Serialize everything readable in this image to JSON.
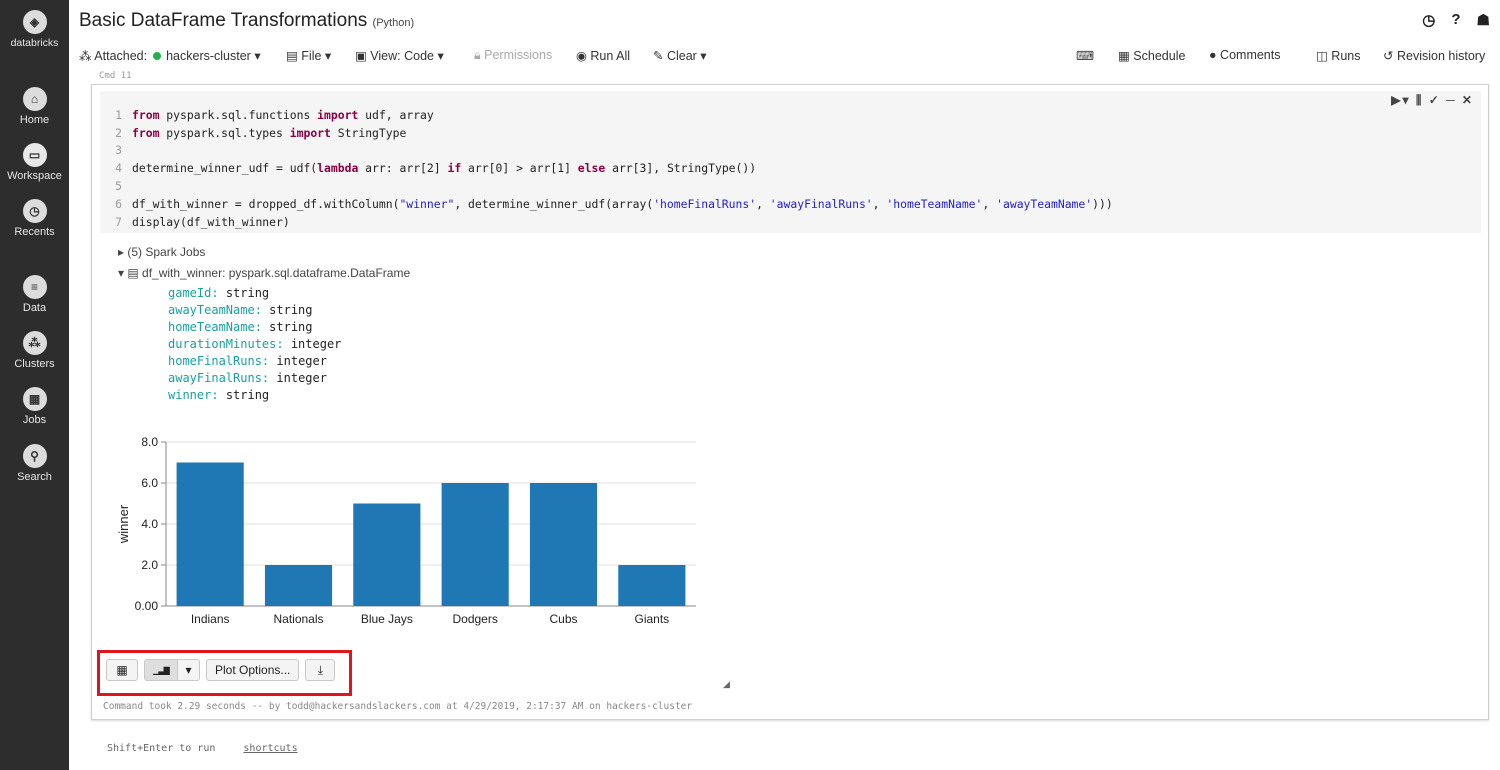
{
  "sidebar": {
    "brand": "databricks",
    "items": [
      {
        "label": "Home",
        "icon": "home-icon",
        "glyph": "⌂"
      },
      {
        "label": "Workspace",
        "icon": "folder-icon",
        "glyph": "▭"
      },
      {
        "label": "Recents",
        "icon": "clock-icon",
        "glyph": "◷"
      },
      {
        "label": "Data",
        "icon": "database-icon",
        "glyph": "≡"
      },
      {
        "label": "Clusters",
        "icon": "clusters-icon",
        "glyph": "⁂"
      },
      {
        "label": "Jobs",
        "icon": "calendar-icon",
        "glyph": "▦"
      },
      {
        "label": "Search",
        "icon": "search-icon",
        "glyph": "⚲"
      }
    ]
  },
  "header": {
    "title": "Basic DataFrame Transformations",
    "language": "(Python)",
    "icons": {
      "clock": "◷",
      "help": "?",
      "user": "☗"
    }
  },
  "toolbar": {
    "attached_label": "Attached:",
    "cluster": "hackers-cluster ▾",
    "file": "File ▾",
    "view": "View: Code ▾",
    "permissions": "Permissions",
    "run_all": "Run All",
    "clear": "Clear ▾",
    "keyboard": "⌨",
    "schedule": "Schedule",
    "comments": "Comments",
    "runs": "Runs",
    "revision": "Revision history"
  },
  "cell": {
    "label": "Cmd 11",
    "tools": "▶▾ ⫼ ✓ ─ ✕",
    "code_lines": [
      {
        "n": "1",
        "parts": [
          [
            "kw",
            "from"
          ],
          [
            "p",
            " pyspark.sql.functions "
          ],
          [
            "kw",
            "import"
          ],
          [
            "p",
            " udf, array"
          ]
        ]
      },
      {
        "n": "2",
        "parts": [
          [
            "kw",
            "from"
          ],
          [
            "p",
            " pyspark.sql.types "
          ],
          [
            "kw",
            "import"
          ],
          [
            "p",
            " StringType"
          ]
        ]
      },
      {
        "n": "3",
        "parts": []
      },
      {
        "n": "4",
        "parts": [
          [
            "p",
            "determine_winner_udf = udf("
          ],
          [
            "kw",
            "lambda"
          ],
          [
            "p",
            " arr: arr[2] "
          ],
          [
            "kw",
            "if"
          ],
          [
            "p",
            " arr[0] > arr[1] "
          ],
          [
            "kw",
            "else"
          ],
          [
            "p",
            " arr[3], StringType())"
          ]
        ]
      },
      {
        "n": "5",
        "parts": []
      },
      {
        "n": "6",
        "parts": [
          [
            "p",
            "df_with_winner = dropped_df.withColumn("
          ],
          [
            "str",
            "\"winner\""
          ],
          [
            "p",
            ", determine_winner_udf(array("
          ],
          [
            "str",
            "'homeFinalRuns'"
          ],
          [
            "p",
            ", "
          ],
          [
            "str",
            "'awayFinalRuns'"
          ],
          [
            "p",
            ", "
          ],
          [
            "str",
            "'homeTeamName'"
          ],
          [
            "p",
            ", "
          ],
          [
            "str",
            "'awayTeamName'"
          ],
          [
            "p",
            ")))"
          ]
        ]
      },
      {
        "n": "7",
        "parts": [
          [
            "p",
            "display(df_with_winner)"
          ]
        ]
      }
    ],
    "spark_jobs": "▸ (5) Spark Jobs",
    "df_header": "▾ ▤ df_with_winner:  pyspark.sql.dataframe.DataFrame",
    "schema": [
      {
        "k": "gameId:",
        "t": "string"
      },
      {
        "k": "awayTeamName:",
        "t": "string"
      },
      {
        "k": "homeTeamName:",
        "t": "string"
      },
      {
        "k": "durationMinutes:",
        "t": "integer"
      },
      {
        "k": "homeFinalRuns:",
        "t": "integer"
      },
      {
        "k": "awayFinalRuns:",
        "t": "integer"
      },
      {
        "k": "winner:",
        "t": "string"
      }
    ],
    "controls": {
      "table_glyph": "▦",
      "bar_glyph": "▁▃▇",
      "caret": "▾",
      "plot_options": "Plot Options...",
      "download_glyph": "⤓"
    },
    "resize_glyph": "◢",
    "command_took": "Command took 2.29 seconds -- by todd@hackersandslackers.com at 4/29/2019, 2:17:37 AM on hackers-cluster"
  },
  "chart_data": {
    "type": "bar",
    "categories": [
      "Indians",
      "Nationals",
      "Blue Jays",
      "Dodgers",
      "Cubs",
      "Giants"
    ],
    "values": [
      7,
      2,
      5,
      6,
      6,
      2
    ],
    "ylabel": "winner",
    "yticks": [
      "0.00",
      "2.0",
      "4.0",
      "6.0",
      "8.0"
    ],
    "ylim": [
      0,
      8
    ],
    "grid": true,
    "bar_color": "#1f77b4"
  },
  "footer": {
    "run_hint": "Shift+Enter to run",
    "shortcuts": "shortcuts"
  }
}
